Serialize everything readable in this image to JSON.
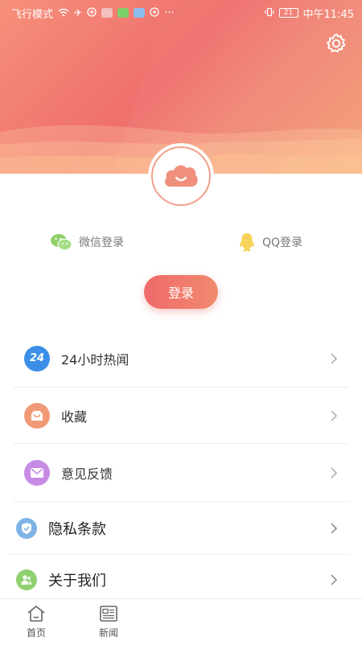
{
  "status_bar": {
    "left_text": "飞行模式",
    "icons": [
      "wifi-icon",
      "airplane-icon",
      "browser-icon",
      "shop-icon",
      "cloud-app-icon",
      "music-app-icon",
      "video-app-icon",
      "more-icon"
    ],
    "more": "···",
    "battery": "21",
    "time": "中午11:45"
  },
  "header": {
    "settings_icon": "gear-icon",
    "gradient_colors": [
      "#f6907a",
      "#ef6f6d",
      "#f5a57c"
    ]
  },
  "login": {
    "wechat_label": "微信登录",
    "qq_label": "QQ登录",
    "button_label": "登录",
    "accent": "#ef6a6b"
  },
  "menu": {
    "items": [
      {
        "label": "24小时热闻",
        "icon": "24-hours-icon",
        "color": "#3b8fe8",
        "badge": "24"
      },
      {
        "label": "收藏",
        "icon": "favorites-box-icon",
        "color": "#f09a78"
      },
      {
        "label": "意见反馈",
        "icon": "mail-feedback-icon",
        "color": "#c78be6"
      },
      {
        "label": "隐私条款",
        "icon": "shield-check-icon",
        "color": "#7fb3e6"
      },
      {
        "label": "关于我们",
        "icon": "people-icon",
        "color": "#8fd16f"
      }
    ]
  },
  "tabbar": {
    "tabs": [
      {
        "label": "首页",
        "icon": "home-icon"
      },
      {
        "label": "新闻",
        "icon": "news-icon"
      }
    ]
  }
}
